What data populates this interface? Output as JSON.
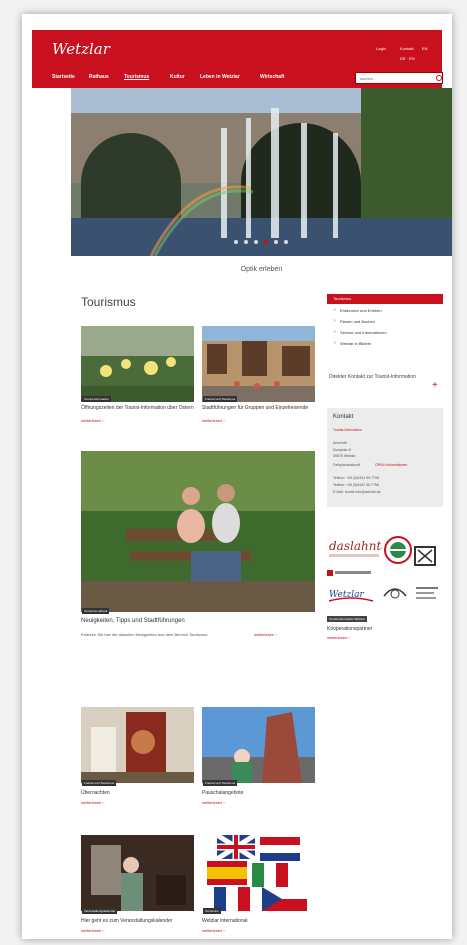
{
  "header": {
    "logo": "Wetzlar",
    "util": [
      "Login",
      "Kontakt",
      "EN"
    ],
    "lang_line": "DE · EN",
    "nav": [
      "Startseite",
      "Rathaus",
      "Tourismus",
      "Kultur",
      "Leben in Wetzlar",
      "Wirtschaft"
    ],
    "active_nav": "Tourismus",
    "search_placeholder": "suchen ..."
  },
  "hero": {
    "caption": "Optik erleben",
    "slides": 6,
    "active_slide": 4
  },
  "main": {
    "title": "Tourismus",
    "cards": [
      {
        "tag": "Tourist-Information",
        "title": "Öffnungszeiten der Tourist-Information über Ostern",
        "more": "weiterlesen ›"
      },
      {
        "tag": "Freizeit und Tourismus",
        "title": "Stadtführungen für Gruppen und Einzelreisende",
        "more": "weiterlesen ›"
      },
      {
        "tag": "Tourismus aktuell",
        "title": "Neuigkeiten, Tipps und Stadtführungen",
        "intro": "Erfahren Sie hier die aktuellen Neuigkeiten aus dem Bereich Tourismus.",
        "more": "weiterlesen ›"
      },
      {
        "tag": "Freizeit und Tourismus",
        "title": "Übernachten",
        "more": "weiterlesen ›"
      },
      {
        "tag": "Freizeit und Tourismus",
        "title": "Pauschalangebote",
        "more": "weiterlesen ›"
      },
      {
        "tag": "Veranstaltungskalender",
        "title": "Hier geht es zum Veranstaltungskalender",
        "more": "weiterlesen ›"
      },
      {
        "tag": "Tourismus",
        "title": "Wetzlar international",
        "more": "weiterlesen ›"
      }
    ]
  },
  "sidebar": {
    "head": "Tourismus",
    "items": [
      "Entdecken und Erleben",
      "Planen und Buchen",
      "Service und Informationen",
      "Wetzlar in Bildern"
    ],
    "direct_contact": "Direkter Kontakt zur Tourist-Information",
    "kontakt": {
      "title": "Kontakt",
      "link": "Tourist-Information",
      "anschrift_label": "Anschrift",
      "street": "Domplatz 8",
      "city": "35578 Wetzlar",
      "directions_label": "Fahrplanauskunft",
      "directions_link": "ÖPNV-Informationen",
      "phone": "Telefon: +49 (0)6441 99-7755",
      "fax": "Telefax: +49 (0)6441 99-7756",
      "email": "E-Mail: tourist-info@wetzlar.de"
    },
    "partner_tag": "Tourist-Information Wetzlar",
    "partner_title": "Kooperationspartner",
    "partner_more": "weiterlesen ›",
    "partner_logos": [
      "Das Lahntal",
      "Lahn-Dill-Bergland",
      "Deutsche Fachwerkstraße",
      "Wetzlar",
      "Lahnwanderweg",
      "Geopark"
    ]
  },
  "colors": {
    "accent": "#c8101f"
  }
}
